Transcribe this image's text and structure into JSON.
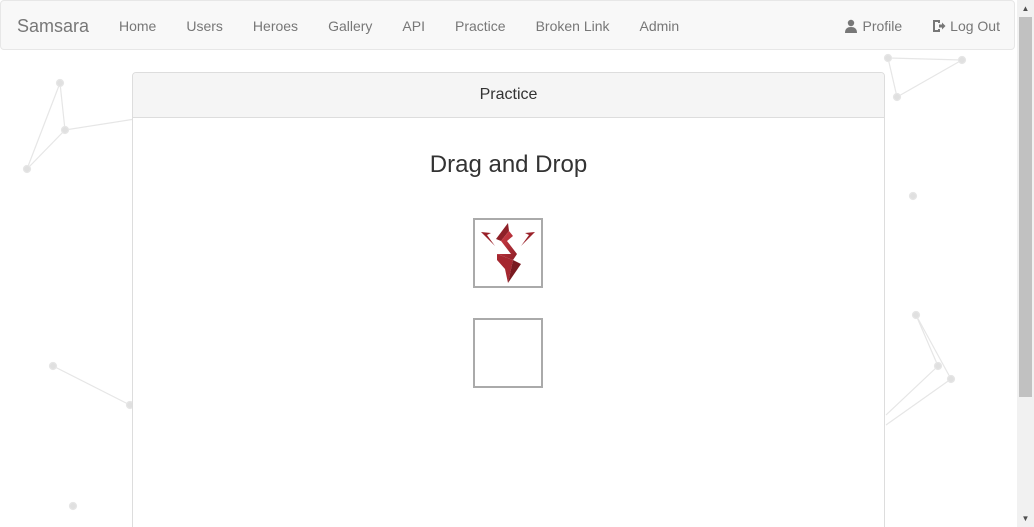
{
  "brand": "Samsara",
  "nav": {
    "left": [
      "Home",
      "Users",
      "Heroes",
      "Gallery",
      "API",
      "Practice",
      "Broken Link",
      "Admin"
    ],
    "profile_label": "Profile",
    "logout_label": "Log Out"
  },
  "panel": {
    "heading": "Practice",
    "title": "Drag and Drop"
  },
  "draggable": {
    "icon": "samsara-logo-icon",
    "logo_color": "#b5313a"
  },
  "icons": {
    "profile": "user-icon",
    "logout": "log-out-icon"
  }
}
